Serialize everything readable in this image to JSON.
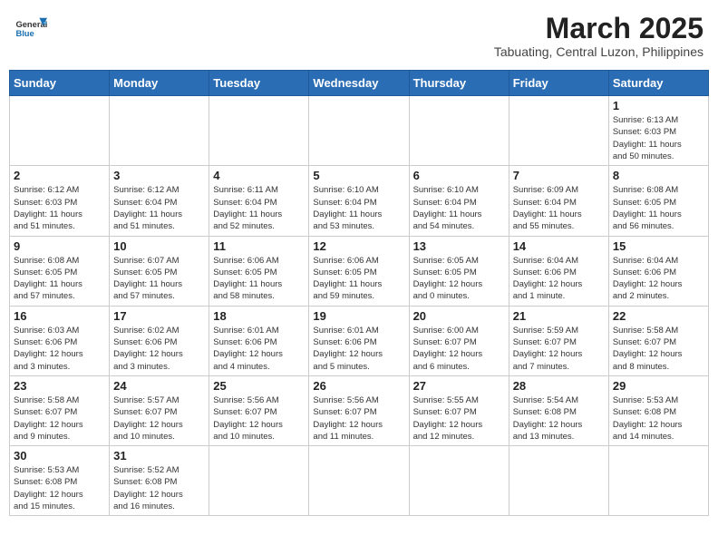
{
  "header": {
    "logo_line1": "General",
    "logo_line2": "Blue",
    "month_title": "March 2025",
    "subtitle": "Tabuating, Central Luzon, Philippines"
  },
  "weekdays": [
    "Sunday",
    "Monday",
    "Tuesday",
    "Wednesday",
    "Thursday",
    "Friday",
    "Saturday"
  ],
  "weeks": [
    [
      {
        "day": "",
        "info": ""
      },
      {
        "day": "",
        "info": ""
      },
      {
        "day": "",
        "info": ""
      },
      {
        "day": "",
        "info": ""
      },
      {
        "day": "",
        "info": ""
      },
      {
        "day": "",
        "info": ""
      },
      {
        "day": "1",
        "info": "Sunrise: 6:13 AM\nSunset: 6:03 PM\nDaylight: 11 hours\nand 50 minutes."
      }
    ],
    [
      {
        "day": "2",
        "info": "Sunrise: 6:12 AM\nSunset: 6:03 PM\nDaylight: 11 hours\nand 51 minutes."
      },
      {
        "day": "3",
        "info": "Sunrise: 6:12 AM\nSunset: 6:04 PM\nDaylight: 11 hours\nand 51 minutes."
      },
      {
        "day": "4",
        "info": "Sunrise: 6:11 AM\nSunset: 6:04 PM\nDaylight: 11 hours\nand 52 minutes."
      },
      {
        "day": "5",
        "info": "Sunrise: 6:10 AM\nSunset: 6:04 PM\nDaylight: 11 hours\nand 53 minutes."
      },
      {
        "day": "6",
        "info": "Sunrise: 6:10 AM\nSunset: 6:04 PM\nDaylight: 11 hours\nand 54 minutes."
      },
      {
        "day": "7",
        "info": "Sunrise: 6:09 AM\nSunset: 6:04 PM\nDaylight: 11 hours\nand 55 minutes."
      },
      {
        "day": "8",
        "info": "Sunrise: 6:08 AM\nSunset: 6:05 PM\nDaylight: 11 hours\nand 56 minutes."
      }
    ],
    [
      {
        "day": "9",
        "info": "Sunrise: 6:08 AM\nSunset: 6:05 PM\nDaylight: 11 hours\nand 57 minutes."
      },
      {
        "day": "10",
        "info": "Sunrise: 6:07 AM\nSunset: 6:05 PM\nDaylight: 11 hours\nand 57 minutes."
      },
      {
        "day": "11",
        "info": "Sunrise: 6:06 AM\nSunset: 6:05 PM\nDaylight: 11 hours\nand 58 minutes."
      },
      {
        "day": "12",
        "info": "Sunrise: 6:06 AM\nSunset: 6:05 PM\nDaylight: 11 hours\nand 59 minutes."
      },
      {
        "day": "13",
        "info": "Sunrise: 6:05 AM\nSunset: 6:05 PM\nDaylight: 12 hours\nand 0 minutes."
      },
      {
        "day": "14",
        "info": "Sunrise: 6:04 AM\nSunset: 6:06 PM\nDaylight: 12 hours\nand 1 minute."
      },
      {
        "day": "15",
        "info": "Sunrise: 6:04 AM\nSunset: 6:06 PM\nDaylight: 12 hours\nand 2 minutes."
      }
    ],
    [
      {
        "day": "16",
        "info": "Sunrise: 6:03 AM\nSunset: 6:06 PM\nDaylight: 12 hours\nand 3 minutes."
      },
      {
        "day": "17",
        "info": "Sunrise: 6:02 AM\nSunset: 6:06 PM\nDaylight: 12 hours\nand 3 minutes."
      },
      {
        "day": "18",
        "info": "Sunrise: 6:01 AM\nSunset: 6:06 PM\nDaylight: 12 hours\nand 4 minutes."
      },
      {
        "day": "19",
        "info": "Sunrise: 6:01 AM\nSunset: 6:06 PM\nDaylight: 12 hours\nand 5 minutes."
      },
      {
        "day": "20",
        "info": "Sunrise: 6:00 AM\nSunset: 6:07 PM\nDaylight: 12 hours\nand 6 minutes."
      },
      {
        "day": "21",
        "info": "Sunrise: 5:59 AM\nSunset: 6:07 PM\nDaylight: 12 hours\nand 7 minutes."
      },
      {
        "day": "22",
        "info": "Sunrise: 5:58 AM\nSunset: 6:07 PM\nDaylight: 12 hours\nand 8 minutes."
      }
    ],
    [
      {
        "day": "23",
        "info": "Sunrise: 5:58 AM\nSunset: 6:07 PM\nDaylight: 12 hours\nand 9 minutes."
      },
      {
        "day": "24",
        "info": "Sunrise: 5:57 AM\nSunset: 6:07 PM\nDaylight: 12 hours\nand 10 minutes."
      },
      {
        "day": "25",
        "info": "Sunrise: 5:56 AM\nSunset: 6:07 PM\nDaylight: 12 hours\nand 10 minutes."
      },
      {
        "day": "26",
        "info": "Sunrise: 5:56 AM\nSunset: 6:07 PM\nDaylight: 12 hours\nand 11 minutes."
      },
      {
        "day": "27",
        "info": "Sunrise: 5:55 AM\nSunset: 6:07 PM\nDaylight: 12 hours\nand 12 minutes."
      },
      {
        "day": "28",
        "info": "Sunrise: 5:54 AM\nSunset: 6:08 PM\nDaylight: 12 hours\nand 13 minutes."
      },
      {
        "day": "29",
        "info": "Sunrise: 5:53 AM\nSunset: 6:08 PM\nDaylight: 12 hours\nand 14 minutes."
      }
    ],
    [
      {
        "day": "30",
        "info": "Sunrise: 5:53 AM\nSunset: 6:08 PM\nDaylight: 12 hours\nand 15 minutes."
      },
      {
        "day": "31",
        "info": "Sunrise: 5:52 AM\nSunset: 6:08 PM\nDaylight: 12 hours\nand 16 minutes."
      },
      {
        "day": "",
        "info": ""
      },
      {
        "day": "",
        "info": ""
      },
      {
        "day": "",
        "info": ""
      },
      {
        "day": "",
        "info": ""
      },
      {
        "day": "",
        "info": ""
      }
    ]
  ]
}
